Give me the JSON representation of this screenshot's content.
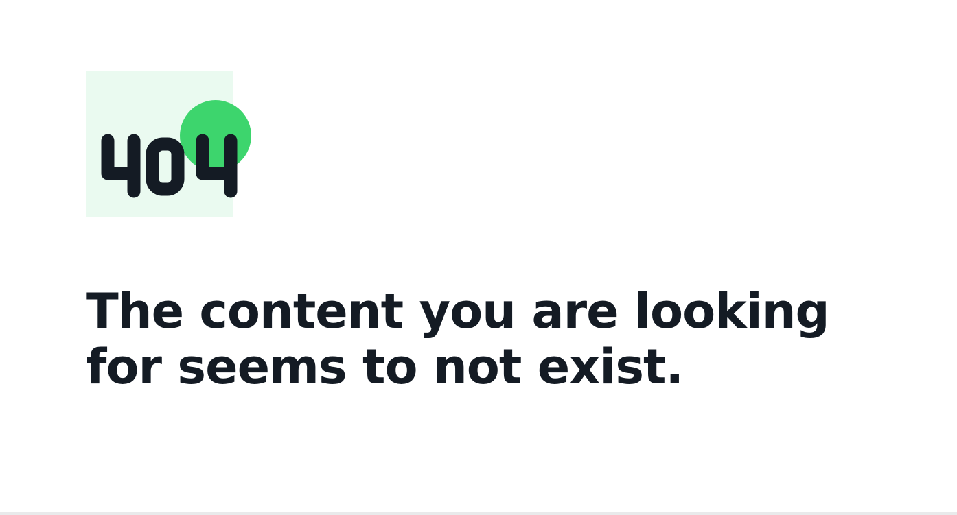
{
  "error": {
    "code": "404",
    "message": "The content you are looking for seems to not exist."
  },
  "colors": {
    "accent": "#3dd56d",
    "accent_light": "#eafaf0",
    "text": "#141b24",
    "divider": "#e9eaeb"
  },
  "icons": [
    "404-illustration-icon"
  ]
}
